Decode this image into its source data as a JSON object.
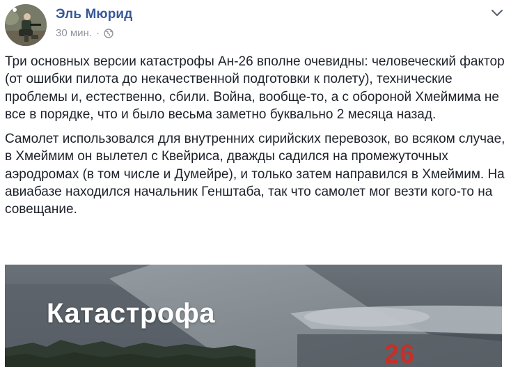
{
  "post": {
    "author": "Эль Мюрид",
    "timestamp": "30 мин.",
    "separator": "·",
    "privacy_icon": "globe-icon",
    "menu_icon": "chevron-down-icon",
    "paragraphs": [
      "Три основных версии катастрофы Ан-26 вполне очевидны: человеческий фактор (от ошибки пилота до некачественной подготовки к полету), технические проблемы и, естественно, сбили. Война, вообще-то, а с обороной Хмеймима не все в порядке, что и было весьма заметно буквально 2 месяца назад.",
      "Самолет использовался для внутренних сирийских перевозок, во всяком случае, в Хмеймим он вылетел с Квейриса, дважды садился на промежуточных аэродромах (в том числе и Думейре), и только затем направился в Хмеймим. На авиабазе находился начальник Генштаба, так что самолет мог везти кого-то на совещание."
    ],
    "image": {
      "overlay_title": "Катастрофа",
      "tail_number": "26"
    }
  },
  "colors": {
    "author_link": "#385898",
    "meta_text": "#90949c",
    "body_text": "#1d2129",
    "tail_number": "#c4302a"
  }
}
